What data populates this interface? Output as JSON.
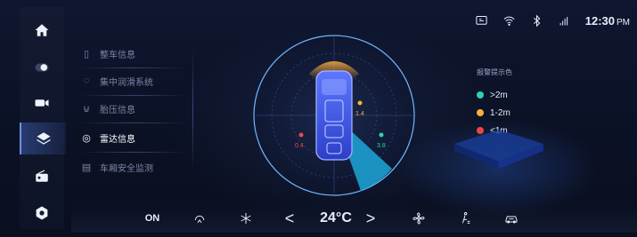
{
  "status_bar": {
    "time": "12:30",
    "ampm": "PM",
    "icons": [
      "screen-icon",
      "wifi-icon",
      "bluetooth-icon",
      "signal-icon"
    ]
  },
  "rail": {
    "items": [
      {
        "name": "home-icon",
        "active": false
      },
      {
        "name": "toggle-icon",
        "active": false
      },
      {
        "name": "camera-icon",
        "active": false
      },
      {
        "name": "layers-icon",
        "active": true
      },
      {
        "name": "radio-icon",
        "active": false
      },
      {
        "name": "settings-icon",
        "active": false
      }
    ]
  },
  "menu": {
    "items": [
      {
        "label": "整车信息",
        "icon": "▯"
      },
      {
        "label": "集中润滑系统",
        "icon": "◌"
      },
      {
        "label": "胎压信息",
        "icon": "⊍"
      },
      {
        "label": "雷达信息",
        "icon": "◎"
      },
      {
        "label": "车厢安全监测",
        "icon": "▤"
      }
    ],
    "active_index": 3
  },
  "radar": {
    "sensors": [
      {
        "value": "0.4",
        "color": "#e8474a"
      },
      {
        "value": "1.4",
        "color": "#f4b13d"
      },
      {
        "value": "3.8",
        "color": "#2ad3b0"
      }
    ]
  },
  "legend": {
    "title": "报警提示色",
    "items": [
      {
        "label": ">2m",
        "color": "#2ad3b0"
      },
      {
        "label": "1-2m",
        "color": "#f4b13d"
      },
      {
        "label": "<1m",
        "color": "#e8474a"
      }
    ]
  },
  "bottom_bar": {
    "on_label": "ON",
    "temperature": "24°C",
    "prev_arrow": "<",
    "next_arrow": ">"
  }
}
